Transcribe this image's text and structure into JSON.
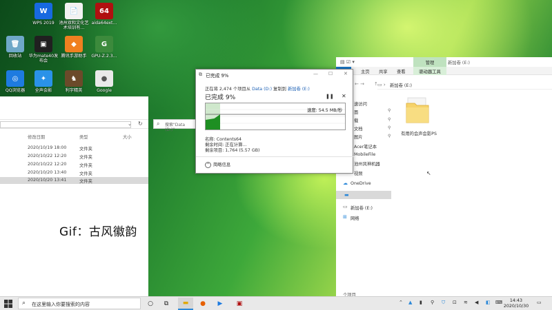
{
  "desktop": {
    "icons": [
      {
        "label": "WPS 2019",
        "icon": "wps-icon",
        "color": "#1769e0",
        "glyph": "W"
      },
      {
        "label": "池州双和文化艺术培训有...",
        "icon": "document-icon",
        "color": "#f2f2f2",
        "glyph": "📄"
      },
      {
        "label": "aida64ext...",
        "icon": "aida64-icon",
        "color": "#b01010",
        "glyph": "64"
      },
      {
        "label": "回收站",
        "icon": "recycle-bin-icon",
        "color": "#6fa8c8",
        "glyph": "🗑"
      },
      {
        "label": "华为mate40发布会",
        "icon": "video-file-icon",
        "color": "#202020",
        "glyph": "▣"
      },
      {
        "label": "腾讯手游助手",
        "icon": "tencent-game-icon",
        "color": "#f08020",
        "glyph": "◆"
      },
      {
        "label": "GPU-Z.2.3...",
        "icon": "gpu-z-icon",
        "color": "#3c8a3c",
        "glyph": "G"
      },
      {
        "label": "QQ浏览器",
        "icon": "qq-browser-icon",
        "color": "#1e7be0",
        "glyph": "◎"
      },
      {
        "label": "全声会影",
        "icon": "video-editor-icon",
        "color": "#2a92e8",
        "glyph": "✦"
      },
      {
        "label": "利字精英",
        "icon": "game-icon",
        "color": "#6b4a2a",
        "glyph": "♞"
      },
      {
        "label": "Google",
        "icon": "chrome-icon",
        "color": "#e9e9e9",
        "glyph": "●"
      }
    ]
  },
  "left_explorer": {
    "search_placeholder": "搜索\"Data (D:)\"",
    "columns": [
      "修改日期",
      "类型",
      "大小"
    ],
    "rows": [
      {
        "date": "2020/10/19 18:00",
        "type": "文件夹"
      },
      {
        "date": "2020/10/22 12:20",
        "type": "文件夹"
      },
      {
        "date": "2020/10/22 12:20",
        "type": "文件夹"
      },
      {
        "date": "2020/10/20 13:40",
        "type": "文件夹"
      },
      {
        "date": "2020/10/20 13:41",
        "type": "文件夹"
      }
    ]
  },
  "right_explorer": {
    "title": "新加卷 (E:)",
    "manage_tab": "管理",
    "ribbon_tabs": [
      "主页",
      "共享",
      "查看"
    ],
    "drive_tools": "驱动器工具",
    "address": "新加卷 (E:)",
    "nav_items": [
      "速访问",
      "面",
      "载",
      "文档",
      "图片",
      "Acer笔记本",
      "MobileFile",
      "池州风神机器",
      "视频",
      "OneDrive",
      "",
      "新加卷 (E:)",
      "网络"
    ],
    "folder_label": "有用的会声会影PS",
    "status": "个项目"
  },
  "copy_dialog": {
    "title": "已完成 9%",
    "line_prefix": "正在将 2,474 个项目从 ",
    "source": "Data (D:)",
    "line_mid": " 复制到 ",
    "dest": "新加卷 (E:)",
    "percent_text": "已完成 9%",
    "progress": 0.09,
    "speed": "速度: 54.5 MB/秒",
    "name_line": "名称: Contents64",
    "time_line": "剩余时间: 正在计算...",
    "items_line": "剩余项目: 1,764 (5.57 GB)",
    "less_info": "简略信息"
  },
  "watermark": "Gif：古风徽韵",
  "taskbar": {
    "search_placeholder": "在这里输入你要搜索的内容",
    "time": "14:43",
    "date": "2020/10/30"
  },
  "colors": {
    "progress_fill": "#cfe8cc",
    "progress_dark": "#1e8f22",
    "link": "#1a5fb4",
    "accent": "#2b88d8"
  }
}
